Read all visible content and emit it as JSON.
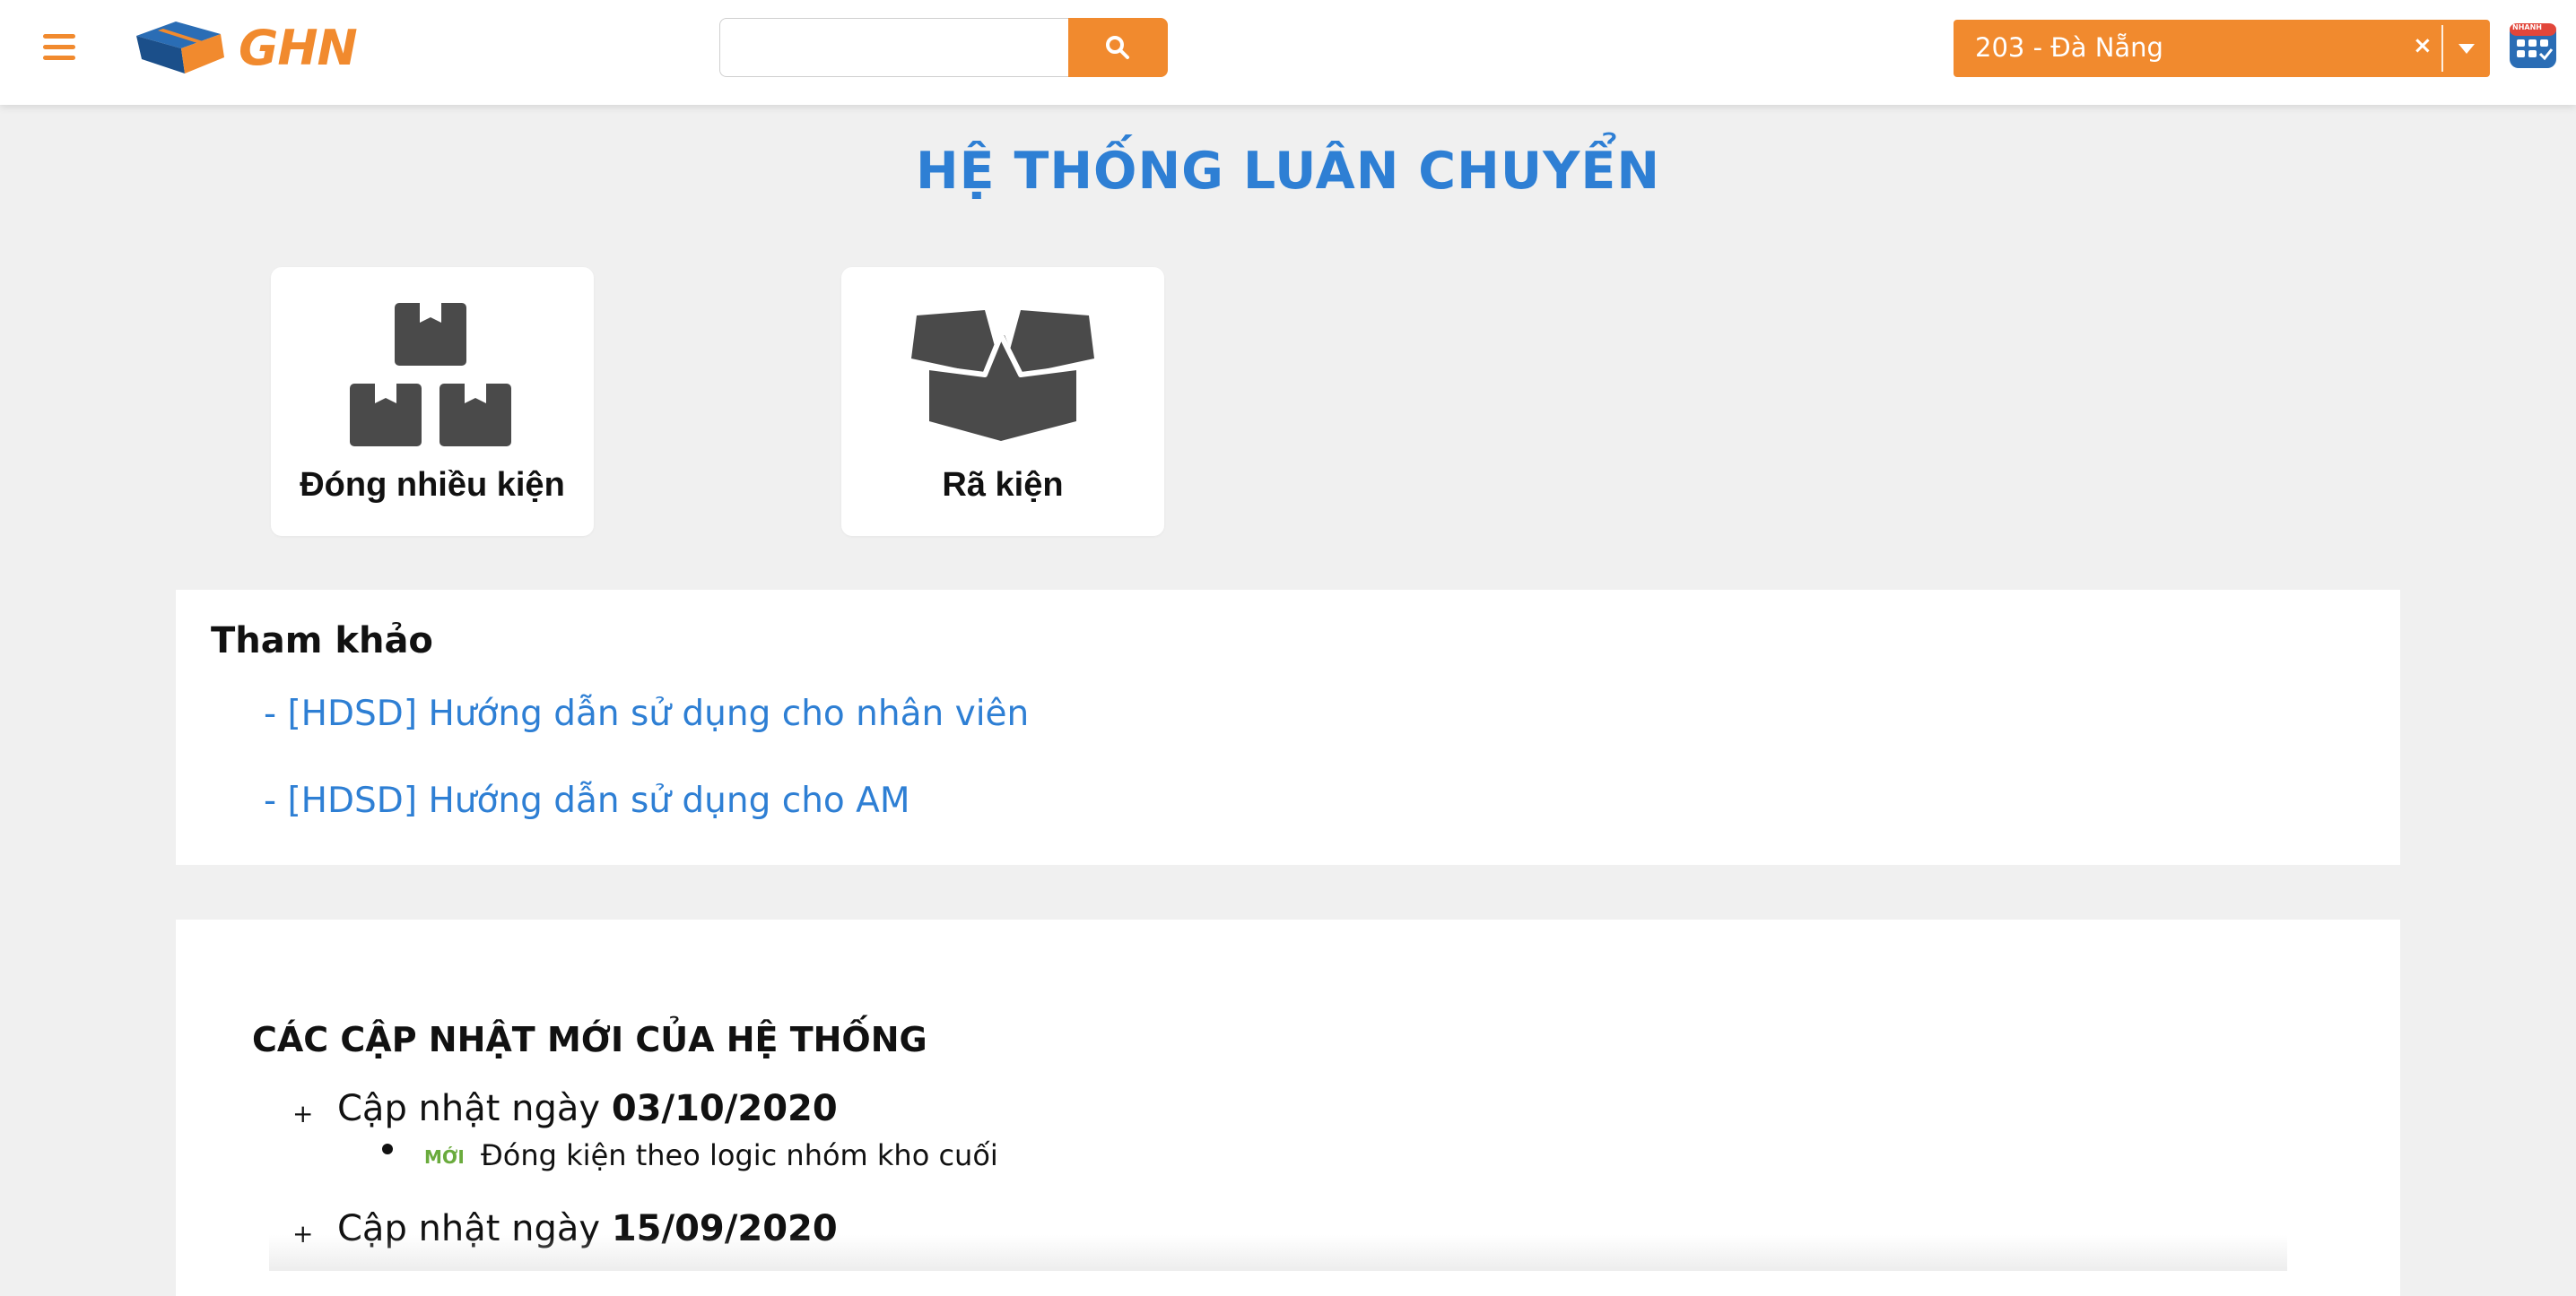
{
  "header": {
    "logo_text": "GHN",
    "search": {
      "value": "",
      "placeholder": ""
    },
    "hub_select": {
      "value": "203 - Đà Nẵng",
      "clear_symbol": "×"
    },
    "app_icon_badge": "NHANH"
  },
  "page_title": "HỆ THỐNG LUÂN CHUYỂN",
  "tiles": [
    {
      "label": "Đóng nhiều kiện",
      "icon": "boxes-stack-icon"
    },
    {
      "label": "Rã kiện",
      "icon": "open-box-icon"
    }
  ],
  "reference": {
    "title": "Tham khảo",
    "links": [
      "- [HDSD] Hướng dẫn sử dụng cho nhân viên",
      "- [HDSD] Hướng dẫn sử dụng cho AM"
    ]
  },
  "updates": {
    "title": "CÁC CẬP NHẬT MỚI CỦA HỆ THỐNG",
    "prefix": "Cập nhật ngày",
    "entries": [
      {
        "date": "03/10/2020",
        "items": [
          {
            "badge": "MỚI",
            "text": "Đóng kiện theo logic nhóm kho cuối"
          }
        ]
      },
      {
        "date": "15/09/2020",
        "items": []
      }
    ]
  },
  "colors": {
    "accent_orange": "#f18a2e",
    "title_blue": "#2e7fd4",
    "new_badge_green": "#6aab3d",
    "background": "#f0f0f0"
  }
}
